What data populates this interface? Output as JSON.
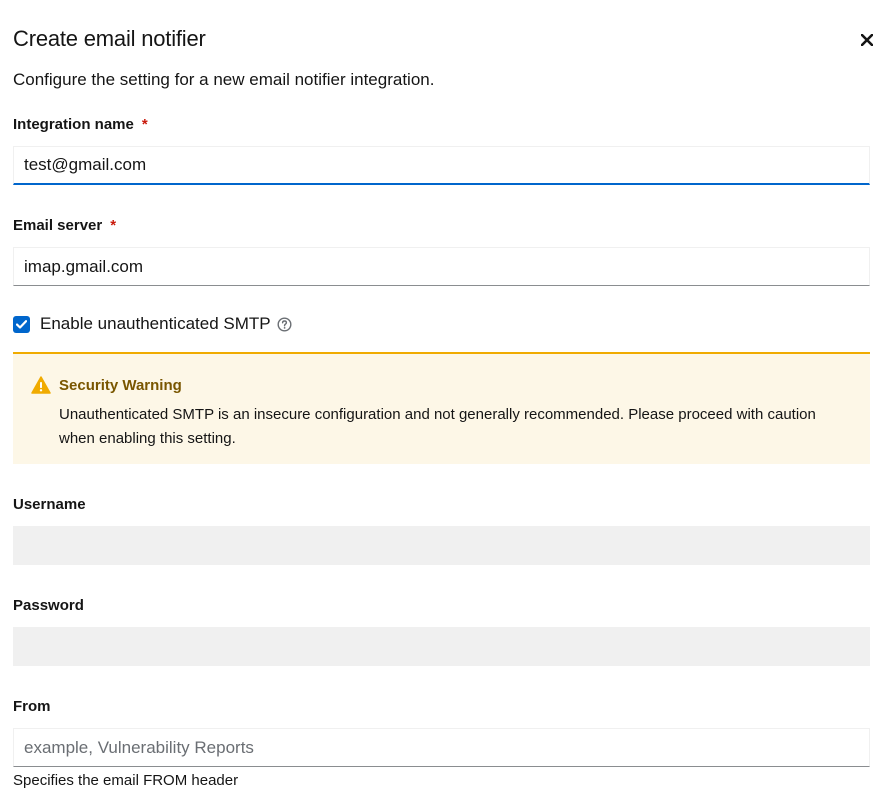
{
  "modal": {
    "title": "Create email notifier",
    "description": "Configure the setting for a new email notifier integration.",
    "close_icon": "close-icon"
  },
  "fields": {
    "integration_name": {
      "label": "Integration name",
      "required_marker": "*",
      "value": "test@gmail.com"
    },
    "email_server": {
      "label": "Email server",
      "required_marker": "*",
      "value": "imap.gmail.com"
    },
    "unauthenticated_smtp": {
      "label": "Enable unauthenticated SMTP",
      "checked": true,
      "help_icon": "question-circle-icon"
    },
    "username": {
      "label": "Username",
      "value": ""
    },
    "password": {
      "label": "Password",
      "value": ""
    },
    "from": {
      "label": "From",
      "value": "",
      "placeholder": "example, Vulnerability Reports",
      "helper_text": "Specifies the email FROM header"
    }
  },
  "alert": {
    "icon": "warning-triangle-icon",
    "title": "Security Warning",
    "body": "Unauthenticated SMTP is an insecure configuration and not generally recommended. Please proceed with caution when enabling this setting."
  },
  "colors": {
    "primary": "#0066cc",
    "required": "#c9190b",
    "warning_accent": "#f0ab00",
    "warning_bg": "#fdf7e7",
    "warning_title": "#795600",
    "disabled_field": "#f0f0f0"
  }
}
